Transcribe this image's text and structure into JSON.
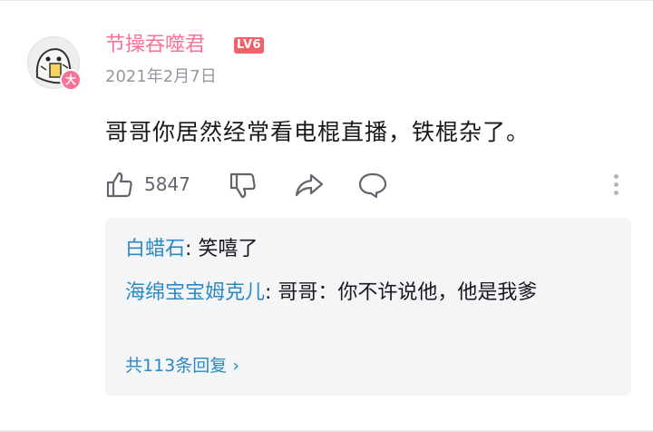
{
  "comment": {
    "username": "节操吞噬君",
    "level_badge": "LV6",
    "avatar_badge": "大",
    "date": "2021年2月7日",
    "text": "哥哥你居然经常看电棍直播，铁棍杂了。",
    "like_count": "5847"
  },
  "replies": [
    {
      "author": "白蜡石",
      "separator": ": ",
      "text": "笑嘻了"
    },
    {
      "author": "海绵宝宝姆克儿",
      "separator": ": ",
      "text": "哥哥：你不许说他，他是我爹"
    }
  ],
  "more_replies": {
    "label": "共113条回复",
    "arrow": "›"
  },
  "colors": {
    "username": "#fb7299",
    "level": "#f0616a",
    "reply_author": "#2b8ac5",
    "reply_bg": "#f4f5f7"
  },
  "icons": [
    "thumbs-up-icon",
    "thumbs-down-icon",
    "share-icon",
    "comment-icon",
    "more-vertical-icon"
  ]
}
